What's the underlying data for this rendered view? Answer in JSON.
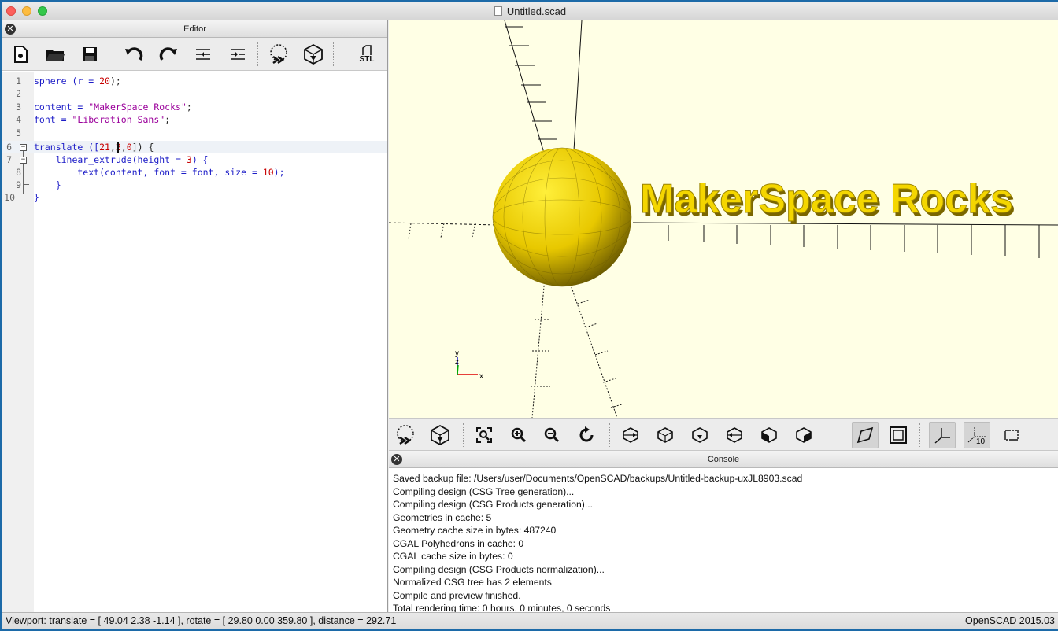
{
  "window": {
    "title": "Untitled.scad"
  },
  "editor": {
    "header": "Editor",
    "toolbar": [
      "new-file-icon",
      "open-file-icon",
      "save-icon",
      "undo-icon",
      "redo-icon",
      "unindent-icon",
      "indent-icon",
      "preview-icon",
      "render-icon",
      "export-stl-icon"
    ],
    "export_label": "STL",
    "line_numbers": [
      "1",
      "2",
      "3",
      "4",
      "5",
      "6",
      "7",
      "8",
      "9",
      "10"
    ],
    "lines": [
      [
        "sphere (r = ",
        "20",
        ");"
      ],
      [],
      [
        "content = ",
        "\"MakerSpace Rocks\"",
        ";"
      ],
      [
        "font = ",
        "\"Liberation Sans\"",
        ";"
      ],
      [],
      [
        "translate ([",
        "21",
        ",",
        "2",
        ",",
        "0",
        "]) {"
      ],
      [
        "    linear_extrude(height = ",
        "3",
        ") {"
      ],
      [
        "        text(content, font = font, size = ",
        "10",
        ");"
      ],
      [
        "    }"
      ],
      [
        "}"
      ]
    ]
  },
  "viewport": {
    "model_text": "MakerSpace Rocks",
    "axis_labels": {
      "y": "y",
      "z": "z",
      "x": "x"
    },
    "colors": {
      "background": "#ffffe5",
      "model": "#f4d600",
      "model_dark": "#8a7400"
    }
  },
  "view_toolbar": [
    "preview-icon",
    "render-icon",
    "view-all-icon",
    "zoom-in-icon",
    "zoom-out-icon",
    "reset-view-icon",
    "view-right-icon",
    "view-top-icon",
    "view-bottom-icon",
    "view-left-icon",
    "view-front-icon",
    "view-back-icon",
    "perspective-icon",
    "orthogonal-icon",
    "show-axes-icon",
    "show-scale-markers-icon",
    "show-edges-icon"
  ],
  "scale_label": "10",
  "console": {
    "header": "Console",
    "lines": [
      "Saved backup file: /Users/user/Documents/OpenSCAD/backups/Untitled-backup-uxJL8903.scad",
      "Compiling design (CSG Tree generation)...",
      "Compiling design (CSG Products generation)...",
      "Geometries in cache: 5",
      "Geometry cache size in bytes: 487240",
      "CGAL Polyhedrons in cache: 0",
      "CGAL cache size in bytes: 0",
      "Compiling design (CSG Products normalization)...",
      "Normalized CSG tree has 2 elements",
      "Compile and preview finished.",
      "Total rendering time: 0 hours, 0 minutes, 0 seconds"
    ]
  },
  "status": {
    "left": "Viewport: translate = [ 49.04 2.38 -1.14 ], rotate = [ 29.80 0.00 359.80 ], distance = 292.71",
    "right": "OpenSCAD 2015.03"
  }
}
